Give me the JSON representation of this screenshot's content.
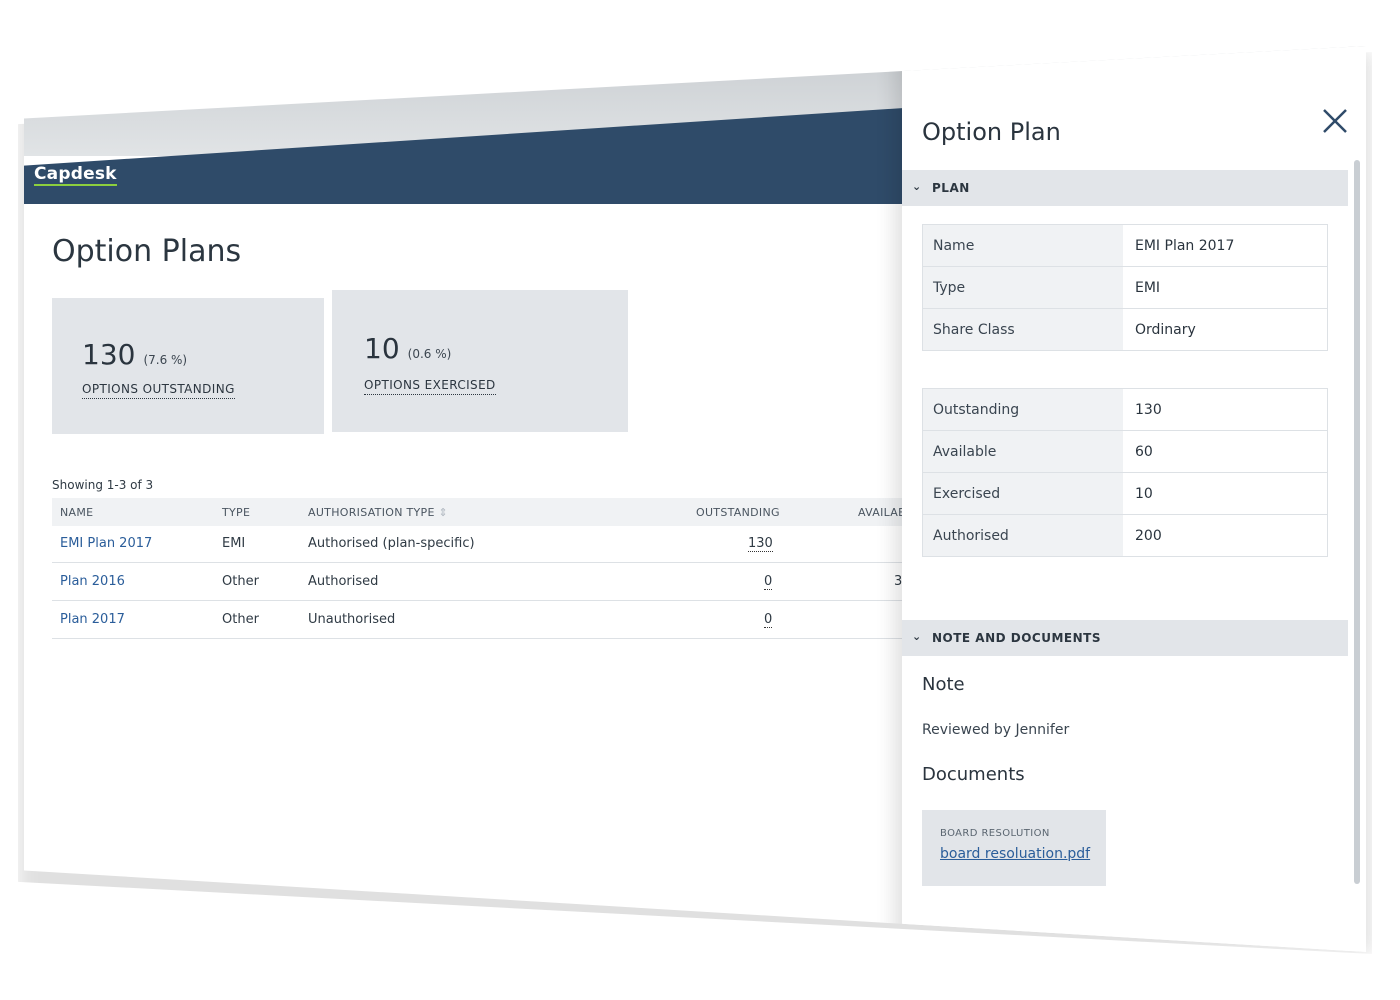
{
  "app": {
    "logo": "Capdesk"
  },
  "page": {
    "title": "Option Plans"
  },
  "stats": [
    {
      "value": "130",
      "percent": "(7.6 %)",
      "label": "OPTIONS OUTSTANDING"
    },
    {
      "value": "10",
      "percent": "(0.6 %)",
      "label": "OPTIONS EXERCISED"
    }
  ],
  "table": {
    "showing": "Showing 1-3 of 3",
    "headers": {
      "name": "NAME",
      "type": "TYPE",
      "auth": "AUTHORISATION TYPE",
      "outstanding": "OUTSTANDING",
      "available": "AVAILAB"
    },
    "rows": [
      {
        "name": "EMI Plan 2017",
        "type": "EMI",
        "auth": "Authorised (plan-specific)",
        "outstanding": "130",
        "available": ""
      },
      {
        "name": "Plan 2016",
        "type": "Other",
        "auth": "Authorised",
        "outstanding": "0",
        "available": "3"
      },
      {
        "name": "Plan 2017",
        "type": "Other",
        "auth": "Unauthorised",
        "outstanding": "0",
        "available": ""
      }
    ]
  },
  "panel": {
    "title": "Option Plan",
    "plan_section": "PLAN",
    "plan_details": [
      {
        "key": "Name",
        "value": "EMI Plan 2017"
      },
      {
        "key": "Type",
        "value": "EMI"
      },
      {
        "key": "Share Class",
        "value": "Ordinary"
      }
    ],
    "plan_numbers": [
      {
        "key": "Outstanding",
        "value": "130"
      },
      {
        "key": "Available",
        "value": "60"
      },
      {
        "key": "Exercised",
        "value": "10"
      },
      {
        "key": "Authorised",
        "value": "200"
      }
    ],
    "notes_section": "NOTE AND DOCUMENTS",
    "note_heading": "Note",
    "note_text": "Reviewed by Jennifer",
    "documents_heading": "Documents",
    "document": {
      "caption": "BOARD RESOLUTION",
      "file": "board resoluation.pdf"
    }
  }
}
